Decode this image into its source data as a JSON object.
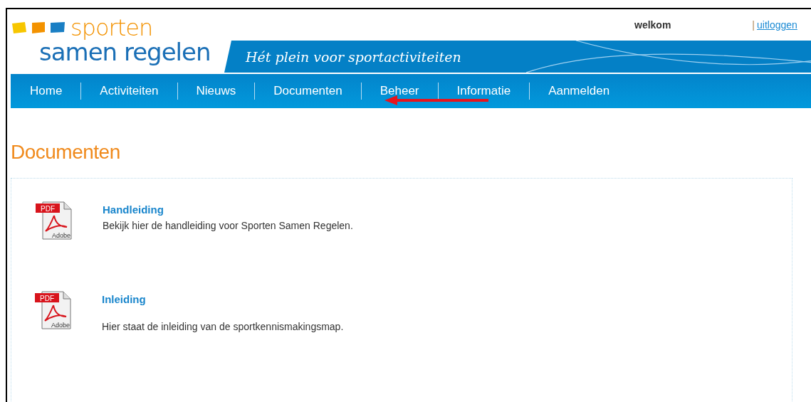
{
  "header": {
    "logo_top": "sporten",
    "logo_bottom": "samen regelen",
    "tagline": "Hét plein voor sportactiviteiten",
    "welcome": "welkom",
    "separator": "|",
    "logout": "uitloggen"
  },
  "nav": [
    {
      "label": "Home"
    },
    {
      "label": "Activiteiten"
    },
    {
      "label": "Nieuws"
    },
    {
      "label": "Documenten"
    },
    {
      "label": "Beheer"
    },
    {
      "label": "Informatie"
    },
    {
      "label": "Aanmelden"
    }
  ],
  "page_title": "Documenten",
  "documents": [
    {
      "icon_badge": "PDF",
      "icon_brand": "Adobe",
      "title": "Handleiding",
      "description": "Bekijk hier de handleiding voor Sporten Samen Regelen."
    },
    {
      "icon_badge": "PDF",
      "icon_brand": "Adobe",
      "title": "Inleiding",
      "description": "Hier staat de inleiding van de sportkennismakingsmap."
    }
  ]
}
